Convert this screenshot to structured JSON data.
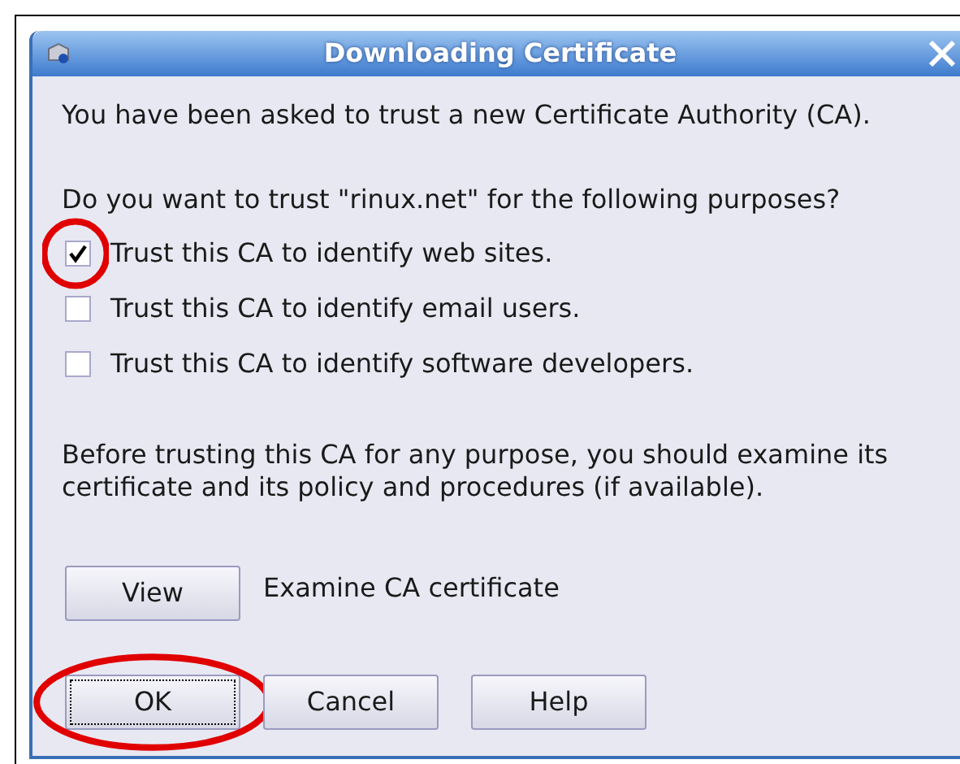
{
  "window": {
    "title": "Downloading Certificate"
  },
  "intro": "You have been asked to trust a new Certificate Authority (CA).",
  "question": "Do you want to trust \"rinux.net\" for the following purposes?",
  "purposes": [
    {
      "label": "Trust this CA to identify web sites.",
      "checked": true,
      "highlighted": true
    },
    {
      "label": "Trust this CA to identify email users.",
      "checked": false,
      "highlighted": false
    },
    {
      "label": "Trust this CA to identify software developers.",
      "checked": false,
      "highlighted": false
    }
  ],
  "advice": "Before trusting this CA for any purpose, you should examine its certificate and its policy and procedures (if available).",
  "view": {
    "button": "View",
    "description": "Examine CA certificate"
  },
  "buttons": [
    {
      "label": "OK",
      "focused": true,
      "highlighted": true
    },
    {
      "label": "Cancel",
      "focused": false,
      "highlighted": false
    },
    {
      "label": "Help",
      "focused": false,
      "highlighted": false
    }
  ]
}
